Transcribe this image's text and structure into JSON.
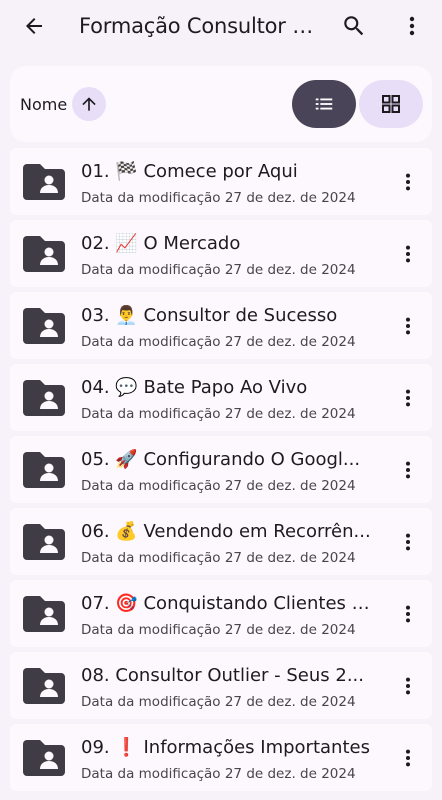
{
  "header": {
    "title": "Formação Consultor e...",
    "back_icon": "arrow-back-icon",
    "search_icon": "search-icon",
    "more_icon": "more-vert-icon"
  },
  "sort": {
    "label": "Nome",
    "direction_icon": "arrow-up-icon",
    "view_list_icon": "list-view-icon",
    "view_grid_icon": "grid-view-icon",
    "active_view": "list"
  },
  "meta_prefix": "Data da modificação",
  "items": [
    {
      "name": "01. 🏁 Comece por Aqui",
      "date": "27 de dez. de 2024"
    },
    {
      "name": "02. 📈 O Mercado",
      "date": "27 de dez. de 2024"
    },
    {
      "name": "03. 👨‍💼 Consultor de Sucesso",
      "date": "27 de dez. de 2024"
    },
    {
      "name": "04. 💬 Bate Papo Ao Vivo",
      "date": "27 de dez. de 2024"
    },
    {
      "name": "05. 🚀 Configurando O Googl...",
      "date": "27 de dez. de 2024"
    },
    {
      "name": "06. 💰 Vendendo em Recorrên...",
      "date": "27 de dez. de 2024"
    },
    {
      "name": "07. 🎯 Conquistando Clientes t...",
      "date": "27 de dez. de 2024"
    },
    {
      "name": "08. Consultor Outlier - Seus 2...",
      "date": "27 de dez. de 2024"
    },
    {
      "name": "09. ❗ Informações Importantes",
      "date": "27 de dez. de 2024"
    }
  ],
  "colors": {
    "background": "#f7f2fa",
    "surface": "#fdf8fd",
    "segment_active": "#4a4458",
    "segment_inactive": "#e8def8",
    "folder": "#3f3c45"
  }
}
